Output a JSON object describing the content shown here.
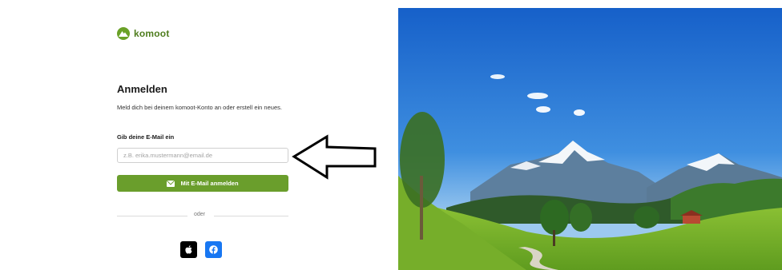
{
  "brand": {
    "name": "komoot",
    "color": "#6aa127",
    "icon": "komoot-logo-icon"
  },
  "login": {
    "title": "Anmelden",
    "description": "Meld dich bei deinem komoot-Konto an oder erstell ein neues.",
    "email_label": "Gib deine E-Mail ein",
    "email_placeholder": "z.B. erika.mustermann@email.de",
    "email_value": "",
    "submit_label": "Mit E-Mail anmelden",
    "submit_icon": "mail-icon",
    "divider_text": "oder",
    "social": [
      {
        "name": "Apple",
        "icon": "apple-icon",
        "color": "#000000"
      },
      {
        "name": "Facebook",
        "icon": "facebook-icon",
        "color": "#1877f2"
      }
    ]
  },
  "annotation": {
    "icon": "arrow-left-icon"
  },
  "hero_image": {
    "subject": "mountain-meadow-landscape"
  }
}
